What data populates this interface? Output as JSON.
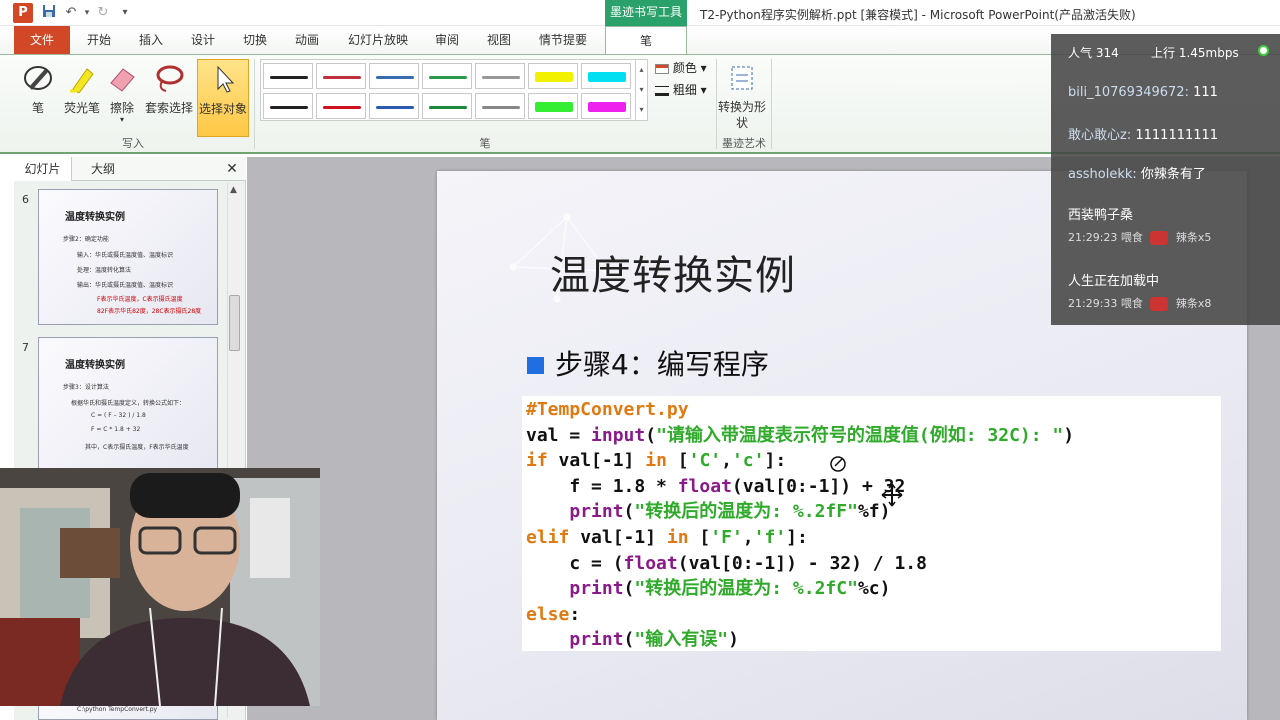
{
  "window": {
    "title": "T2-Python程序实例解析.ppt [兼容模式] - Microsoft PowerPoint(产品激活失败)",
    "context_tab_group": "墨迹书写工具"
  },
  "quick_access": {
    "app_letter": "P",
    "save_icon": "save-icon",
    "undo_icon": "undo-icon",
    "redo_icon": "redo-icon"
  },
  "tabs": [
    "文件",
    "开始",
    "插入",
    "设计",
    "切换",
    "动画",
    "幻灯片放映",
    "审阅",
    "视图",
    "情节提要",
    "笔"
  ],
  "ribbon": {
    "write_group": {
      "label": "写入",
      "tools": [
        "笔",
        "荧光笔",
        "擦除",
        "套索选择",
        "选择对象"
      ]
    },
    "pens_group": {
      "label": "笔",
      "color_label": "颜色",
      "weight_label": "粗细"
    },
    "ink_art_group": {
      "label": "墨迹艺术",
      "convert_label": "转换为形状"
    },
    "pen_colors_row1": [
      "#222222",
      "#c0303a",
      "#3a6ab0",
      "#2a9a4a",
      "#999999",
      "#f2f200",
      "#00e0f0"
    ],
    "pen_colors_row2": [
      "#222222",
      "#d01020",
      "#2a5ab0",
      "#1a8a3a",
      "#888888",
      "#33ee33",
      "#ee22ee"
    ]
  },
  "left_panel": {
    "tabs": [
      "幻灯片",
      "大纲"
    ],
    "close_label": "✕",
    "slides": [
      {
        "number": "6",
        "title": "温度转换实例",
        "lines": [
          "步骤2：确定功能",
          "输入：华氏或摄氏温度值、温度标识",
          "处理：温度转化算法",
          "输出：华氏或摄氏温度值、温度标识",
          "F表示华氏温度，C表示摄氏温度",
          "82F表示华氏82度，28C表示摄氏28度"
        ]
      },
      {
        "number": "7",
        "title": "温度转换实例",
        "lines": [
          "步骤3：设计算法",
          "根据华氏和摄氏温度定义，转换公式如下：",
          "C = ( F – 32 ) / 1.8",
          "F = C * 1.8 + 32",
          "其中，C表示摄氏温度，F表示华氏温度"
        ]
      }
    ],
    "partial_bottom_text": "C:\\python TempConvert.py"
  },
  "slide": {
    "title": "温度转换实例",
    "step": "步骤4：编写程序",
    "code": [
      [
        {
          "t": "#TempConvert.py",
          "c": "cm"
        }
      ],
      [
        {
          "t": "val = ",
          "c": "bk"
        },
        {
          "t": "input",
          "c": "fn"
        },
        {
          "t": "(",
          "c": "bk"
        },
        {
          "t": "\"请输入带温度表示符号的温度值(例如: 32C): \"",
          "c": "st"
        },
        {
          "t": ")",
          "c": "bk"
        }
      ],
      [
        {
          "t": "if",
          "c": "kw"
        },
        {
          "t": " val[-1] ",
          "c": "bk"
        },
        {
          "t": "in",
          "c": "kw"
        },
        {
          "t": " [",
          "c": "bk"
        },
        {
          "t": "'C'",
          "c": "st"
        },
        {
          "t": ",",
          "c": "bk"
        },
        {
          "t": "'c'",
          "c": "st"
        },
        {
          "t": "]:",
          "c": "bk"
        }
      ],
      [
        {
          "t": "    f = 1.8 * ",
          "c": "bk"
        },
        {
          "t": "float",
          "c": "fn"
        },
        {
          "t": "(val[0:-1]) + 32",
          "c": "bk"
        }
      ],
      [
        {
          "t": "    ",
          "c": "bk"
        },
        {
          "t": "print",
          "c": "fn"
        },
        {
          "t": "(",
          "c": "bk"
        },
        {
          "t": "\"转换后的温度为: %.2fF\"",
          "c": "st"
        },
        {
          "t": "%f)",
          "c": "bk"
        }
      ],
      [
        {
          "t": "elif",
          "c": "kw"
        },
        {
          "t": " val[-1] ",
          "c": "bk"
        },
        {
          "t": "in",
          "c": "kw"
        },
        {
          "t": " [",
          "c": "bk"
        },
        {
          "t": "'F'",
          "c": "st"
        },
        {
          "t": ",",
          "c": "bk"
        },
        {
          "t": "'f'",
          "c": "st"
        },
        {
          "t": "]:",
          "c": "bk"
        }
      ],
      [
        {
          "t": "    c = (",
          "c": "bk"
        },
        {
          "t": "float",
          "c": "fn"
        },
        {
          "t": "(val[0:-1]) - 32) / 1.8",
          "c": "bk"
        }
      ],
      [
        {
          "t": "    ",
          "c": "bk"
        },
        {
          "t": "print",
          "c": "fn"
        },
        {
          "t": "(",
          "c": "bk"
        },
        {
          "t": "\"转换后的温度为: %.2fC\"",
          "c": "st"
        },
        {
          "t": "%c)",
          "c": "bk"
        }
      ],
      [
        {
          "t": "else",
          "c": "kw"
        },
        {
          "t": ":",
          "c": "bk"
        }
      ],
      [
        {
          "t": "    ",
          "c": "bk"
        },
        {
          "t": "print",
          "c": "fn"
        },
        {
          "t": "(",
          "c": "bk"
        },
        {
          "t": "\"输入有误\"",
          "c": "st"
        },
        {
          "t": ")",
          "c": "bk"
        }
      ]
    ]
  },
  "chat_overlay": {
    "popularity": "人气  314",
    "upload": "上行  1.45mbps",
    "messages": [
      {
        "user": "bili_10769349672:",
        "text": "111"
      },
      {
        "user": "敢心敢心z:",
        "text": "1111111111"
      },
      {
        "user": "assholekk:",
        "text": "你辣条有了"
      }
    ],
    "gifts": [
      {
        "user": "西装鸭子桑",
        "time": "21:29:23",
        "action": "喂食",
        "item": "辣条x5"
      },
      {
        "user": "人生正在加载中",
        "time": "21:29:33",
        "action": "喂食",
        "item": "辣条x8"
      }
    ],
    "status_color": "#3ecf3e"
  },
  "webcam": {
    "label": "webcam-feed"
  }
}
